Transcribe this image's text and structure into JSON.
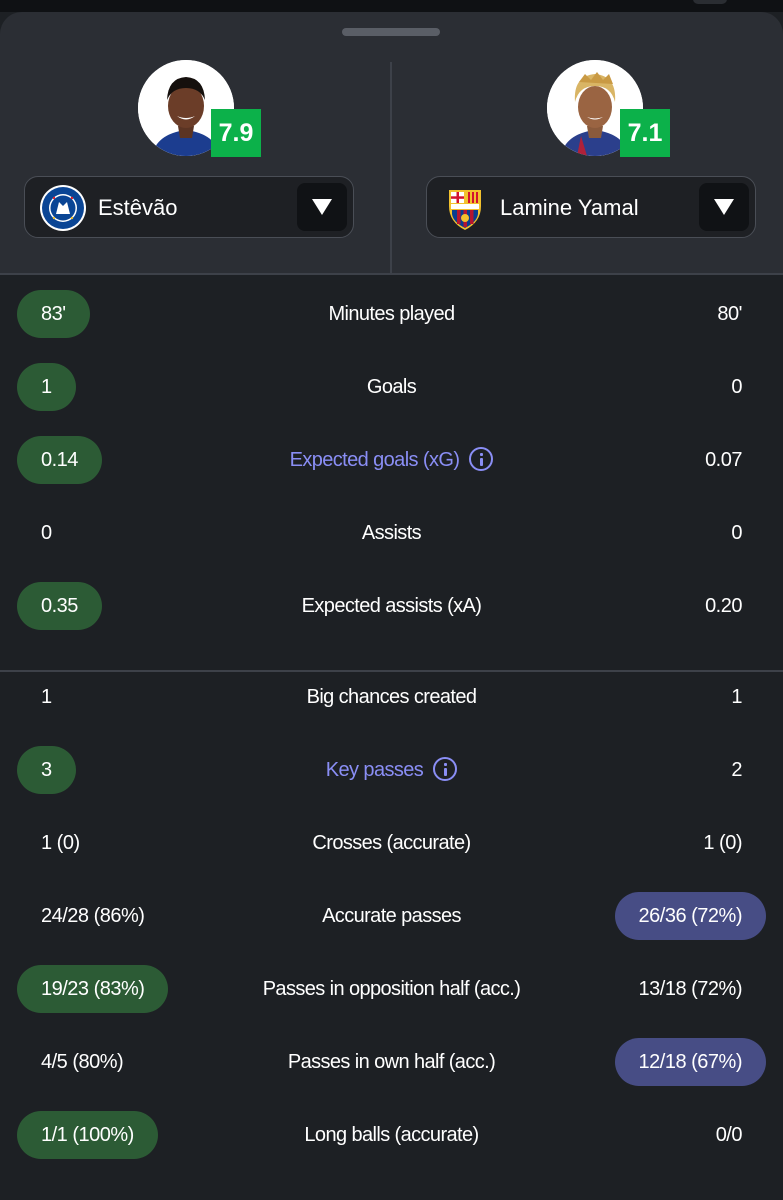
{
  "players": {
    "left": {
      "name": "Estêvão",
      "rating": "7.9",
      "club_icon": "chelsea-crest-icon"
    },
    "right": {
      "name": "Lamine Yamal",
      "rating": "7.1",
      "club_icon": "barcelona-crest-icon"
    }
  },
  "colors": {
    "left_highlight": "#2c5b35",
    "right_highlight": "#474d85",
    "rating_badge": "#0cb14a",
    "link": "#8a8ef5"
  },
  "stats": [
    {
      "label": "Minutes played",
      "left": "83'",
      "right": "80'",
      "left_hl": true,
      "right_hl": false,
      "info": false
    },
    {
      "label": "Goals",
      "left": "1",
      "right": "0",
      "left_hl": true,
      "right_hl": false,
      "info": false
    },
    {
      "label": "Expected goals (xG)",
      "left": "0.14",
      "right": "0.07",
      "left_hl": true,
      "right_hl": false,
      "info": true
    },
    {
      "label": "Assists",
      "left": "0",
      "right": "0",
      "left_hl": false,
      "right_hl": false,
      "info": false
    },
    {
      "label": "Expected assists (xA)",
      "left": "0.35",
      "right": "0.20",
      "left_hl": true,
      "right_hl": false,
      "info": false
    },
    {
      "label": "Big chances created",
      "left": "1",
      "right": "1",
      "left_hl": false,
      "right_hl": false,
      "info": false
    },
    {
      "label": "Key passes",
      "left": "3",
      "right": "2",
      "left_hl": true,
      "right_hl": false,
      "info": true
    },
    {
      "label": "Crosses (accurate)",
      "left": "1 (0)",
      "right": "1 (0)",
      "left_hl": false,
      "right_hl": false,
      "info": false
    },
    {
      "label": "Accurate passes",
      "left": "24/28 (86%)",
      "right": "26/36 (72%)",
      "left_hl": false,
      "right_hl": true,
      "info": false
    },
    {
      "label": "Passes in opposition half (acc.)",
      "left": "19/23 (83%)",
      "right": "13/18 (72%)",
      "left_hl": true,
      "right_hl": false,
      "info": false
    },
    {
      "label": "Passes in own half (acc.)",
      "left": "4/5 (80%)",
      "right": "12/18 (67%)",
      "left_hl": false,
      "right_hl": true,
      "info": false
    },
    {
      "label": "Long balls (accurate)",
      "left": "1/1 (100%)",
      "right": "0/0",
      "left_hl": true,
      "right_hl": false,
      "info": false
    }
  ]
}
